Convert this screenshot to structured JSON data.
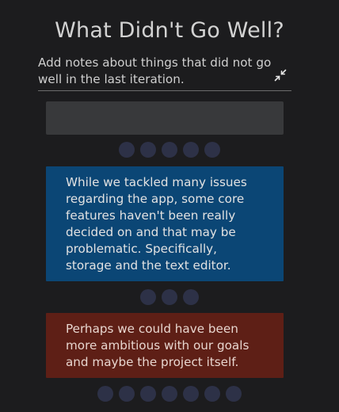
{
  "section": {
    "title": "What Didn't Go Well?"
  },
  "notes": {
    "text": "Add notes about things that did not go well in the last iteration.",
    "collapse_icon": "collapse-arrows-icon"
  },
  "new_item": {
    "value": ""
  },
  "cards": [
    {
      "text": "While we tackled many issues regarding the app, some core features haven't been really decided on and that may be problematic. Specifically, storage and the text editor.",
      "color": "#0b4675",
      "vote_dots": 3
    },
    {
      "text": "Perhaps we could have been more ambitious with our goals and maybe the project itself.",
      "color": "#5e1f16",
      "vote_dots": 7
    }
  ],
  "new_item_vote_dots": 5,
  "colors": {
    "background": "#1c1c1e",
    "dot": "#2d3147",
    "input": "#38393b"
  }
}
